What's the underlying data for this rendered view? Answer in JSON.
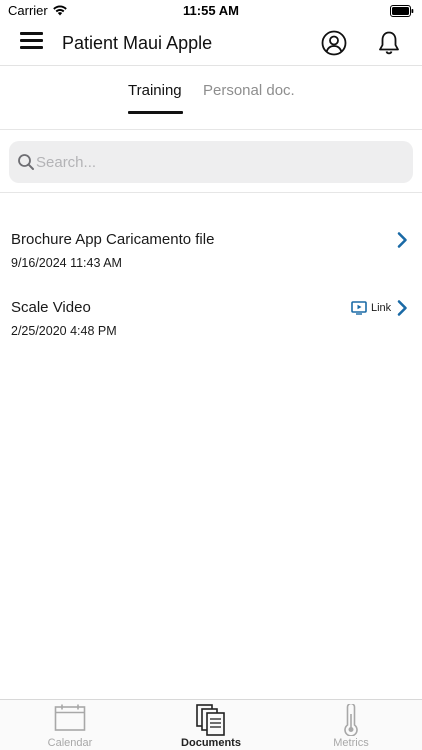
{
  "status_bar": {
    "carrier": "Carrier",
    "time": "11:55 AM",
    "wifi_icon": "wifi-icon",
    "battery_icon": "battery-icon"
  },
  "header": {
    "title": "Patient Maui Apple",
    "menu_icon": "hamburger-menu-icon",
    "profile_icon": "user-circle-icon",
    "bell_icon": "bell-icon"
  },
  "tabs": [
    {
      "label": "Training",
      "active": true
    },
    {
      "label": "Personal doc.",
      "active": false
    }
  ],
  "search": {
    "placeholder": "Search...",
    "value": ""
  },
  "documents": [
    {
      "title": "Brochure App Caricamento file",
      "date": "9/16/2024 11:43 AM",
      "link": null
    },
    {
      "title": "Scale Video",
      "date": "2/25/2020 4:48 PM",
      "link": {
        "label": "Link",
        "icon": "video-screen-icon"
      }
    }
  ],
  "tab_bar": {
    "items": [
      {
        "label": "Calendar",
        "icon": "calendar-icon",
        "active": false
      },
      {
        "label": "Documents",
        "icon": "documents-icon",
        "active": true
      },
      {
        "label": "Metrics",
        "icon": "thermometer-icon",
        "active": false
      }
    ]
  },
  "colors": {
    "accent": "#1a6aa6",
    "active_text": "#111111",
    "inactive_text": "#8e8e8e",
    "search_bg": "#eeeeef"
  }
}
